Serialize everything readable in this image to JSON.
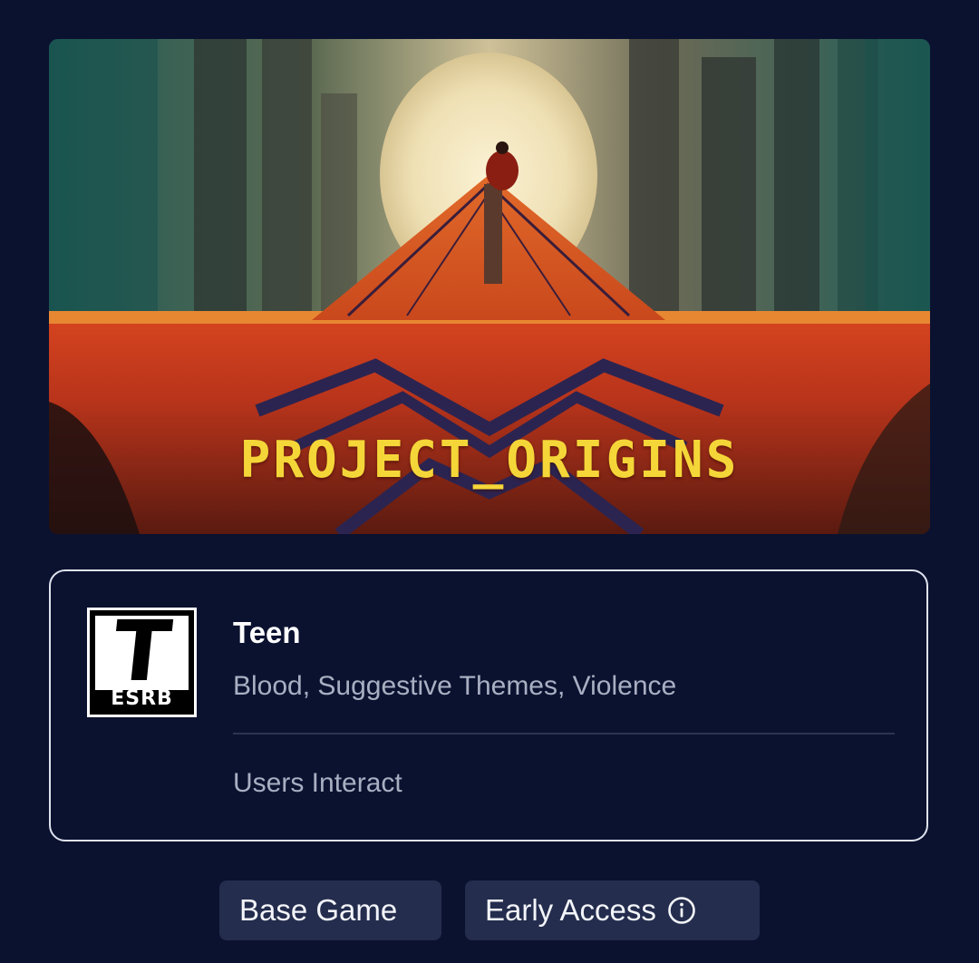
{
  "hero": {
    "title": "PROJECT_ORIGINS"
  },
  "rating": {
    "badge_letter": "T",
    "badge_label": "ESRB",
    "title": "Teen",
    "descriptors": "Blood, Suggestive Themes, Violence",
    "interactive_elements": "Users Interact"
  },
  "tags": {
    "base_game": "Base Game",
    "early_access": "Early Access",
    "early_access_icon": "info-icon"
  },
  "colors": {
    "background": "#0b1230",
    "tag_background": "#242d4d",
    "title_yellow": "#f5d638",
    "muted_text": "#a9afc2"
  }
}
